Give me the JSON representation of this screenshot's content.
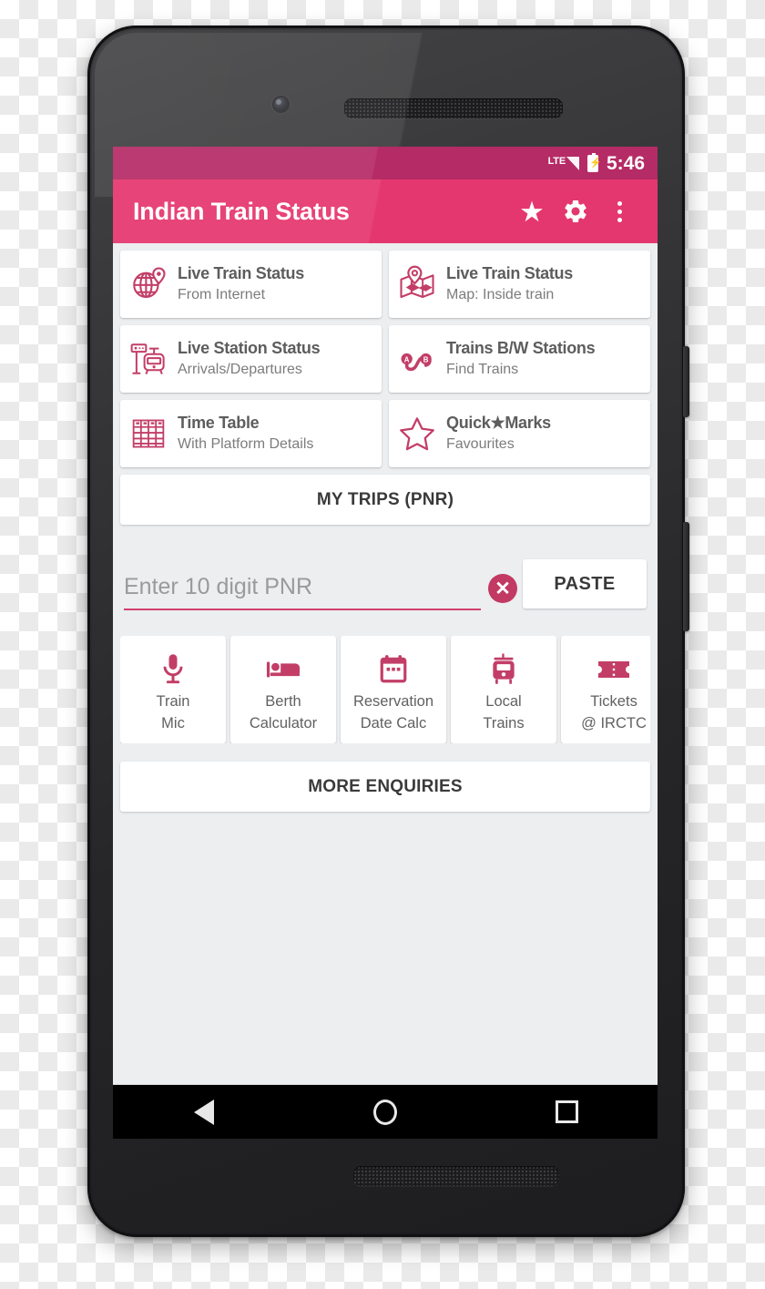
{
  "device": {
    "frame": "android-phone",
    "bezel_color": "#2a2a2c",
    "camera": "front-camera",
    "earpiece": "earpiece-speaker-grille",
    "bottom_speaker": "bottom-speaker-grille",
    "side_buttons": [
      "power-button",
      "volume-rocker"
    ]
  },
  "colors": {
    "status_bar": "#b52b66",
    "app_bar": "#e5376f",
    "accent": "#c33e67",
    "screen_bg": "#eceef0",
    "card_bg": "#ffffff",
    "nav_bar": "#000000"
  },
  "status_bar": {
    "network_label": "LTE",
    "signal_icon": "signal-bars-icon",
    "battery_icon": "battery-charging-icon",
    "time": "5:46"
  },
  "app_bar": {
    "title": "Indian Train Status",
    "actions": [
      {
        "name": "favourites-star-button",
        "icon": "star-icon",
        "glyph": "★"
      },
      {
        "name": "settings-button",
        "icon": "gear-icon"
      },
      {
        "name": "overflow-menu-button",
        "icon": "more-vertical-icon"
      }
    ]
  },
  "menu_cards": [
    {
      "title": "Live Train Status",
      "subtitle": "From Internet",
      "icon": "globe-pin-icon",
      "name": "card-live-train-status-internet"
    },
    {
      "title": "Live Train Status",
      "subtitle": "Map: Inside train",
      "icon": "map-pin-icon",
      "name": "card-live-train-status-map"
    },
    {
      "title": "Live Station Status",
      "subtitle": "Arrivals/Departures",
      "icon": "station-sign-icon",
      "name": "card-live-station-status"
    },
    {
      "title": "Trains B/W Stations",
      "subtitle": "Find Trains",
      "icon": "route-ab-icon",
      "name": "card-trains-between-stations"
    },
    {
      "title": "Time Table",
      "subtitle": "With Platform Details",
      "icon": "timetable-grid-icon",
      "name": "card-time-table"
    },
    {
      "title": "Quick★Marks",
      "subtitle": "Favourites",
      "icon": "star-outline-icon",
      "name": "card-quick-marks"
    }
  ],
  "my_trips_button": {
    "label": "MY TRIPS (PNR)"
  },
  "pnr": {
    "placeholder": "Enter 10 digit PNR",
    "value": "",
    "clear_icon": "clear-circle-icon",
    "clear_glyph": "✕",
    "paste_label": "PASTE"
  },
  "tools": [
    {
      "line1": "Train",
      "line2": "Mic",
      "icon": "microphone-icon",
      "name": "tool-train-mic"
    },
    {
      "line1": "Berth",
      "line2": "Calculator",
      "icon": "bed-icon",
      "name": "tool-berth-calculator"
    },
    {
      "line1": "Reservation",
      "line2": "Date Calc",
      "icon": "calendar-icon",
      "name": "tool-reservation-date-calc"
    },
    {
      "line1": "Local",
      "line2": "Trains",
      "icon": "tram-icon",
      "name": "tool-local-trains"
    },
    {
      "line1": "Tickets",
      "line2": "@ IRCTC",
      "icon": "ticket-icon",
      "name": "tool-tickets-irctc"
    }
  ],
  "more_enquiries_button": {
    "label": "MORE ENQUIRIES"
  },
  "nav_bar": {
    "keys": [
      {
        "name": "nav-back-button",
        "icon": "triangle-back-icon"
      },
      {
        "name": "nav-home-button",
        "icon": "circle-home-icon"
      },
      {
        "name": "nav-recents-button",
        "icon": "square-recents-icon"
      }
    ]
  }
}
